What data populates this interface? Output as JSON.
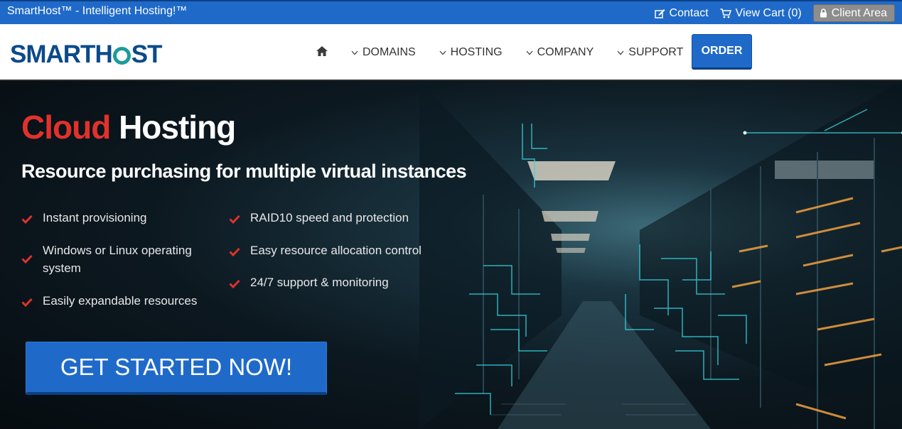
{
  "topbar": {
    "tagline": "SmartHost™ - Intelligent Hosting!™",
    "contact": "Contact",
    "cart": "View Cart (0)",
    "client_area": "Client Area"
  },
  "header": {
    "logo": {
      "part1": "SMART",
      "part2": "H",
      "part3": "ST"
    },
    "nav": [
      "DOMAINS",
      "HOSTING",
      "COMPANY",
      "SUPPORT"
    ],
    "order": "ORDER"
  },
  "hero": {
    "title_red": "Cloud",
    "title_white": "Hosting",
    "subtitle": "Resource purchasing for multiple virtual instances",
    "features_left": [
      "Instant provisioning",
      "Windows or Linux operating system",
      "Easily expandable resources"
    ],
    "features_right": [
      "RAID10 speed and protection",
      "Easy resource allocation control",
      "24/7 support & monitoring"
    ],
    "cta": "GET STARTED NOW!"
  },
  "colors": {
    "brand_blue": "#1f6ac9",
    "accent_red": "#e0322b",
    "logo_navy": "#0b4a8a",
    "logo_teal": "#1c9b9b"
  },
  "icons": [
    "edit-icon",
    "cart-icon",
    "lock-icon",
    "home-icon",
    "chevron-down-icon",
    "checkmark-icon"
  ]
}
